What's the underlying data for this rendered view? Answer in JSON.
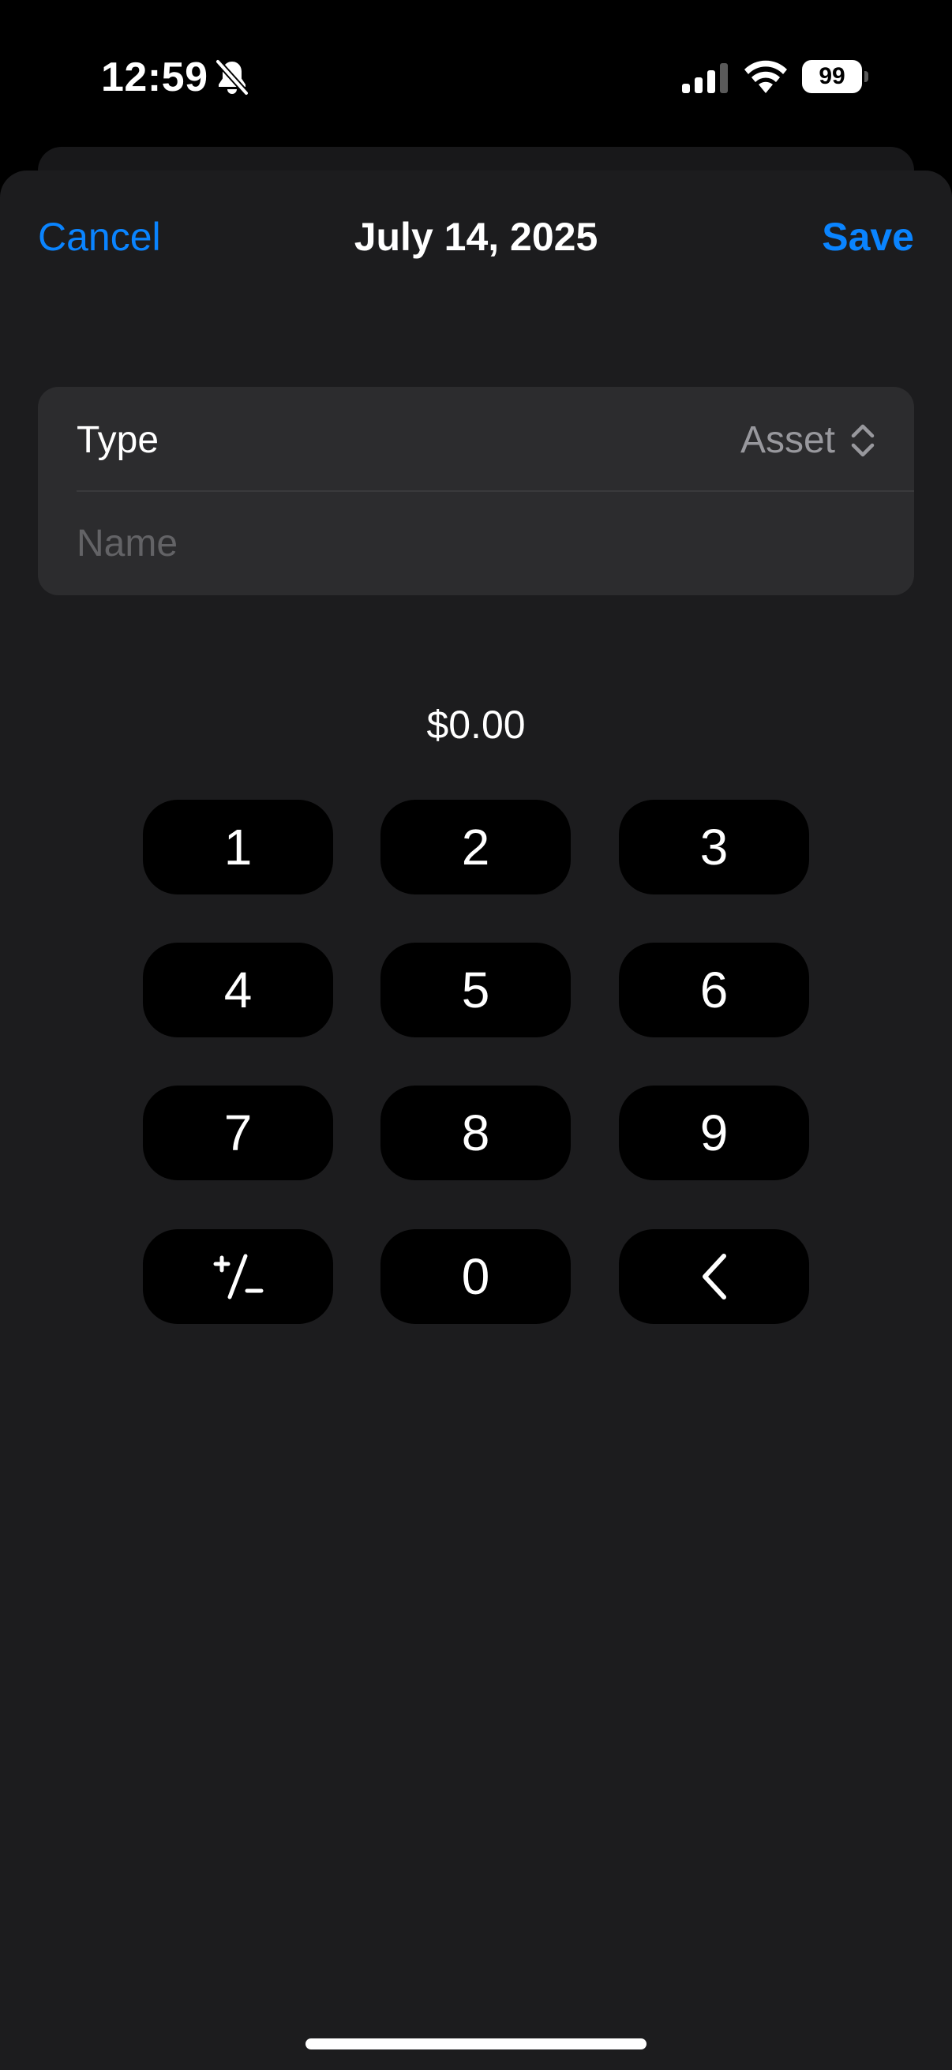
{
  "status_bar": {
    "time": "12:59",
    "battery_level": "99",
    "icons": [
      "bell-slash-icon",
      "cellular-signal-icon",
      "wifi-icon",
      "battery-icon"
    ]
  },
  "nav": {
    "cancel_label": "Cancel",
    "title": "July 14, 2025",
    "save_label": "Save"
  },
  "form": {
    "type_label": "Type",
    "type_value": "Asset",
    "name_value": "",
    "name_placeholder": "Name"
  },
  "amount": "$0.00",
  "keypad": {
    "k1": "1",
    "k2": "2",
    "k3": "3",
    "k4": "4",
    "k5": "5",
    "k6": "6",
    "k7": "7",
    "k8": "8",
    "k9": "9",
    "k0": "0",
    "plus_minus_icon": "plus-minus-icon",
    "backspace_icon": "chevron-left-icon"
  },
  "colors": {
    "accent": "#0a84ff",
    "sheet_bg": "#1c1c1e",
    "group_bg": "#2c2c2e",
    "key_bg": "#000000",
    "secondary_text": "#98989d",
    "placeholder_text": "#636366"
  }
}
